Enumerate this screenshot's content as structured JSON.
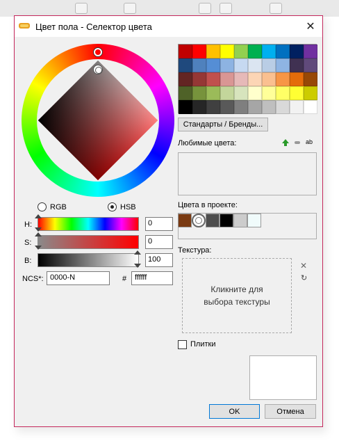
{
  "window": {
    "title": "Цвет пола - Селектор цвета",
    "close_glyph": "✕"
  },
  "color_model": {
    "rgb_label": "RGB",
    "hsb_label": "HSB",
    "selected": "HSB"
  },
  "hsb": {
    "h_label": "H:",
    "h_value": "0",
    "s_label": "S:",
    "s_value": "0",
    "b_label": "B:",
    "b_value": "100"
  },
  "ncs": {
    "label": "NCS*:",
    "value": "0000-N"
  },
  "hex": {
    "label": "#",
    "value": "ffffff"
  },
  "palette": {
    "colors": [
      "#c00000",
      "#ff0000",
      "#ffc000",
      "#ffff00",
      "#92d050",
      "#00b050",
      "#00b0f0",
      "#0070c0",
      "#002060",
      "#7030a0",
      "#1f497d",
      "#4f81bd",
      "#558ed5",
      "#8db3e2",
      "#c6d9f1",
      "#dbe5f1",
      "#b9cde5",
      "#8eb4e3",
      "#403152",
      "#604a7b",
      "#632523",
      "#953735",
      "#c0504d",
      "#d99694",
      "#e6b9b8",
      "#fcd5b5",
      "#fac090",
      "#f79646",
      "#e46c0a",
      "#974806",
      "#4f6228",
      "#77933c",
      "#9bbb59",
      "#c3d69b",
      "#d7e4bd",
      "#ffffcc",
      "#ffff99",
      "#ffff66",
      "#ffff33",
      "#cccc00",
      "#000000",
      "#262626",
      "#404040",
      "#595959",
      "#7f7f7f",
      "#a6a6a6",
      "#bfbfbf",
      "#d9d9d9",
      "#f2f2f2",
      "#ffffff"
    ]
  },
  "standards_button": "Стандарты / Бренды...",
  "favorites": {
    "label": "Любимые цвета:",
    "add_icon": "plus-icon",
    "remove_icon": "minus-icon",
    "rename_label": "ab"
  },
  "project_colors": {
    "label": "Цвета в проекте:",
    "colors": [
      "#7a3a12",
      "#ffffff",
      "#4d4d4d",
      "#000000",
      "#cccccc",
      "#f0fbfb"
    ]
  },
  "texture": {
    "label": "Текстура:",
    "placeholder": "Кликните для выбора текстуры",
    "clear_icon": "clear-icon",
    "rotate_icon": "rotate-icon"
  },
  "tiles": {
    "label": "Плитки",
    "checked": false
  },
  "buttons": {
    "ok": "OK",
    "cancel": "Отмена"
  },
  "accent_color": "#c4275c"
}
